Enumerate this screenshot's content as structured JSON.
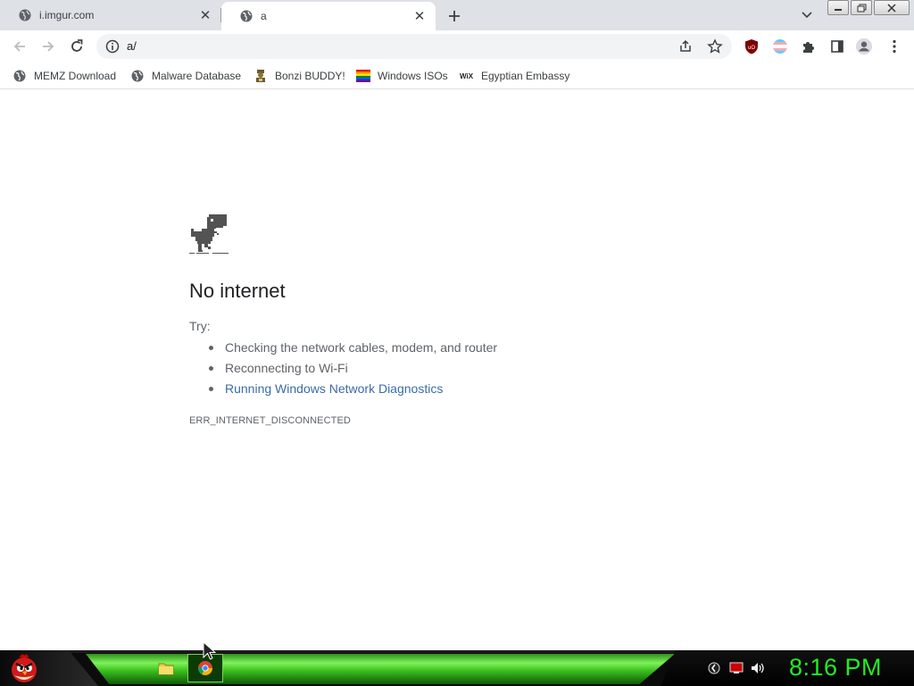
{
  "tabs": [
    {
      "title": "i.imgur.com",
      "favicon": "globe-icon",
      "active": false
    },
    {
      "title": "a",
      "favicon": "globe-icon",
      "active": true
    }
  ],
  "toolbar": {
    "url": "a/"
  },
  "bookmarks": [
    {
      "label": "MEMZ Download",
      "icon": "globe-icon"
    },
    {
      "label": "Malware Database",
      "icon": "globe-icon"
    },
    {
      "label": "Bonzi BUDDY!",
      "icon": "bonzi-icon"
    },
    {
      "label": "Windows ISOs",
      "icon": "rainbow-flag-icon"
    },
    {
      "label": "Egyptian Embassy",
      "icon": "wix-icon"
    }
  ],
  "error_page": {
    "title": "No internet",
    "try_label": "Try:",
    "suggestions": [
      "Checking the network cables, modem, and router",
      "Reconnecting to Wi-Fi",
      "Running Windows Network Diagnostics"
    ],
    "error_code": "ERR_INTERNET_DISCONNECTED"
  },
  "taskbar": {
    "clock": "8:16 PM"
  },
  "colors": {
    "tabstrip_bg": "#dee1e6",
    "omnibox_bg": "#f1f3f4",
    "link": "#3b6ba8",
    "clock": "#22ee22",
    "taskbar_green": "#3cc01f"
  }
}
